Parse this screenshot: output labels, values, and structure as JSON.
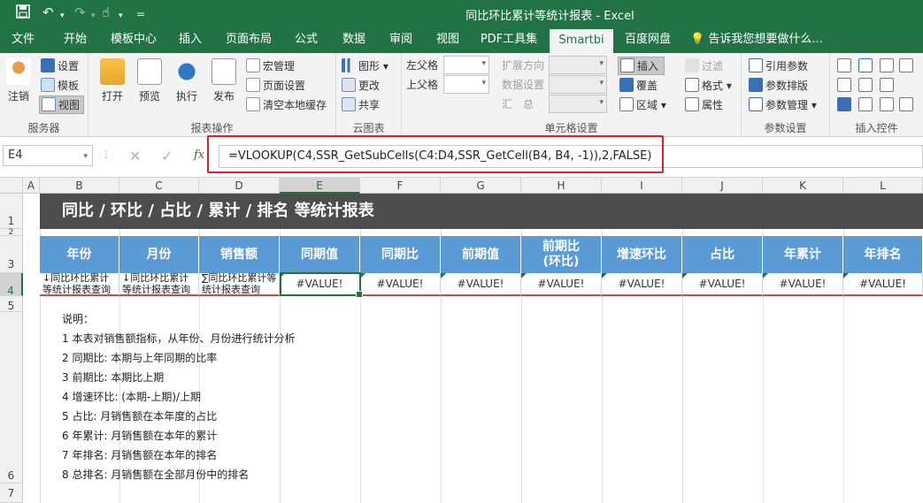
{
  "window": {
    "title": "同比环比累计等统计报表 - Excel"
  },
  "quick_access": {
    "save_icon": "save-icon",
    "undo_icon": "undo-icon",
    "redo_icon": "redo-icon",
    "touch_icon": "touch-mode-icon",
    "customize": "="
  },
  "tabs": [
    "文件",
    "开始",
    "模板中心",
    "插入",
    "页面布局",
    "公式",
    "数据",
    "审阅",
    "视图",
    "PDF工具集",
    "Smartbi",
    "百度网盘"
  ],
  "active_tab": "Smartbi",
  "tell_me": "告诉我您想要做什么...",
  "ribbon": {
    "server": {
      "label": "服务器",
      "logout": "注销",
      "settings": "设置",
      "template": "模板",
      "view": "视图"
    },
    "report_ops": {
      "label": "报表操作",
      "open": "打开",
      "preview": "预览",
      "execute": "执行",
      "publish": "发布",
      "macro": "宏管理",
      "page_setup": "页面设置",
      "clear_cache": "清空本地缓存"
    },
    "cloud": {
      "label": "云图表",
      "chart": "图形",
      "update": "更改",
      "share": "共享"
    },
    "cell_settings": {
      "label": "单元格设置",
      "left_parent": "左父格",
      "top_parent": "上父格",
      "expand_dir": "扩展方向",
      "data_settings": "数据设置",
      "summary": "汇　总",
      "insert": "插入",
      "overwrite": "覆盖",
      "area": "区域",
      "filter": "过滤",
      "format": "格式",
      "property": "属性"
    },
    "params": {
      "label": "参数设置",
      "ref_param": "引用参数",
      "param_layout": "参数排版",
      "param_manage": "参数管理"
    },
    "controls": {
      "label": "插入控件"
    }
  },
  "formula_bar": {
    "name_box": "E4",
    "cancel": "✕",
    "enter": "✓",
    "fx": "fx",
    "formula": "=VLOOKUP(C4,SSR_GetSubCells(C4:D4,SSR_GetCell(B4, B4, -1)),2,FALSE)"
  },
  "sheet": {
    "columns": [
      "A",
      "B",
      "C",
      "D",
      "E",
      "F",
      "G",
      "H",
      "I",
      "J",
      "K",
      "L"
    ],
    "selected_column": "E",
    "rows": [
      "1",
      "2",
      "3",
      "4",
      "5",
      "6",
      "7"
    ],
    "selected_row": "4",
    "banner": "同比 / 环比 / 占比 / 累计 / 排名 等统计报表",
    "headers": [
      "年份",
      "月份",
      "销售额",
      "同期值",
      "同期比",
      "前期值",
      "前期比\n(环比)",
      "增速环比",
      "占比",
      "年累计",
      "年排名"
    ],
    "row4": {
      "b": "↓同比环比累计等统计报表查询",
      "c": "↓同比环比累计等统计报表查询",
      "d": "∑同比环比累计等统计报表查询",
      "values": [
        "#VALUE!",
        "#VALUE!",
        "#VALUE!",
        "#VALUE!",
        "#VALUE!",
        "#VALUE!",
        "#VALUE!",
        "#VALUE!"
      ]
    },
    "notes": [
      "说明：",
      "1 本表对销售额指标，从年份、月份进行统计分析",
      "2 同期比: 本期与上年同期的比率",
      "3 前期比: 本期比上期",
      "4 增速环比: (本期-上期)/上期",
      "5 占比: 月销售额在本年度的占比",
      "6 年累计: 月销售额在本年的累计",
      "7 年排名: 月销售额在本年的排名",
      "8 总排名: 月销售额在全部月份中的排名"
    ]
  },
  "colors": {
    "excel_green": "#217346",
    "header_blue": "#5b9bd5",
    "banner_gray": "#4d4d4d",
    "highlight_red": "#e02020"
  }
}
